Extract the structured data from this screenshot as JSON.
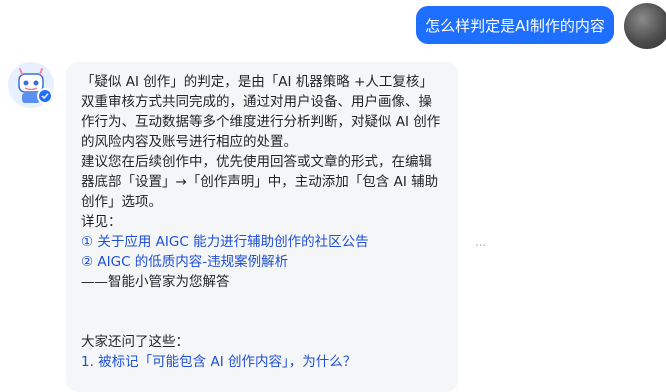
{
  "user_message": {
    "text": "怎么样判定是AI制作的内容"
  },
  "bot_message": {
    "paragraph1": "「疑似 AI 创作」的判定，是由「AI 机器策略 +人工复核」双重审核方式共同完成的，通过对用户设备、用户画像、操作行为、互动数据等多个维度进行分析判断，对疑似 AI 创作的风险内容及账号进行相应的处置。",
    "paragraph2": "建议您在后续创作中，优先使用回答或文章的形式，在编辑器底部「设置」→「创作声明」中，主动添加「包含 AI 辅助创作」选项。",
    "details_label": "详见：",
    "links": [
      {
        "label": "① 关于应用 AIGC 能力进行辅助创作的社区公告"
      },
      {
        "label": "② AIGC 的低质内容-违规案例解析"
      }
    ],
    "signature": "——智能小管家为您解答",
    "related_title": "大家还问了这些：",
    "related_questions": [
      {
        "label": "1. 被标记「可能包含 AI 创作内容」，为什么？"
      }
    ]
  },
  "more_icon": "…",
  "colors": {
    "accent": "#1e6fff",
    "link": "#1f4fd6",
    "bubble_bg": "#f5f6f7"
  }
}
